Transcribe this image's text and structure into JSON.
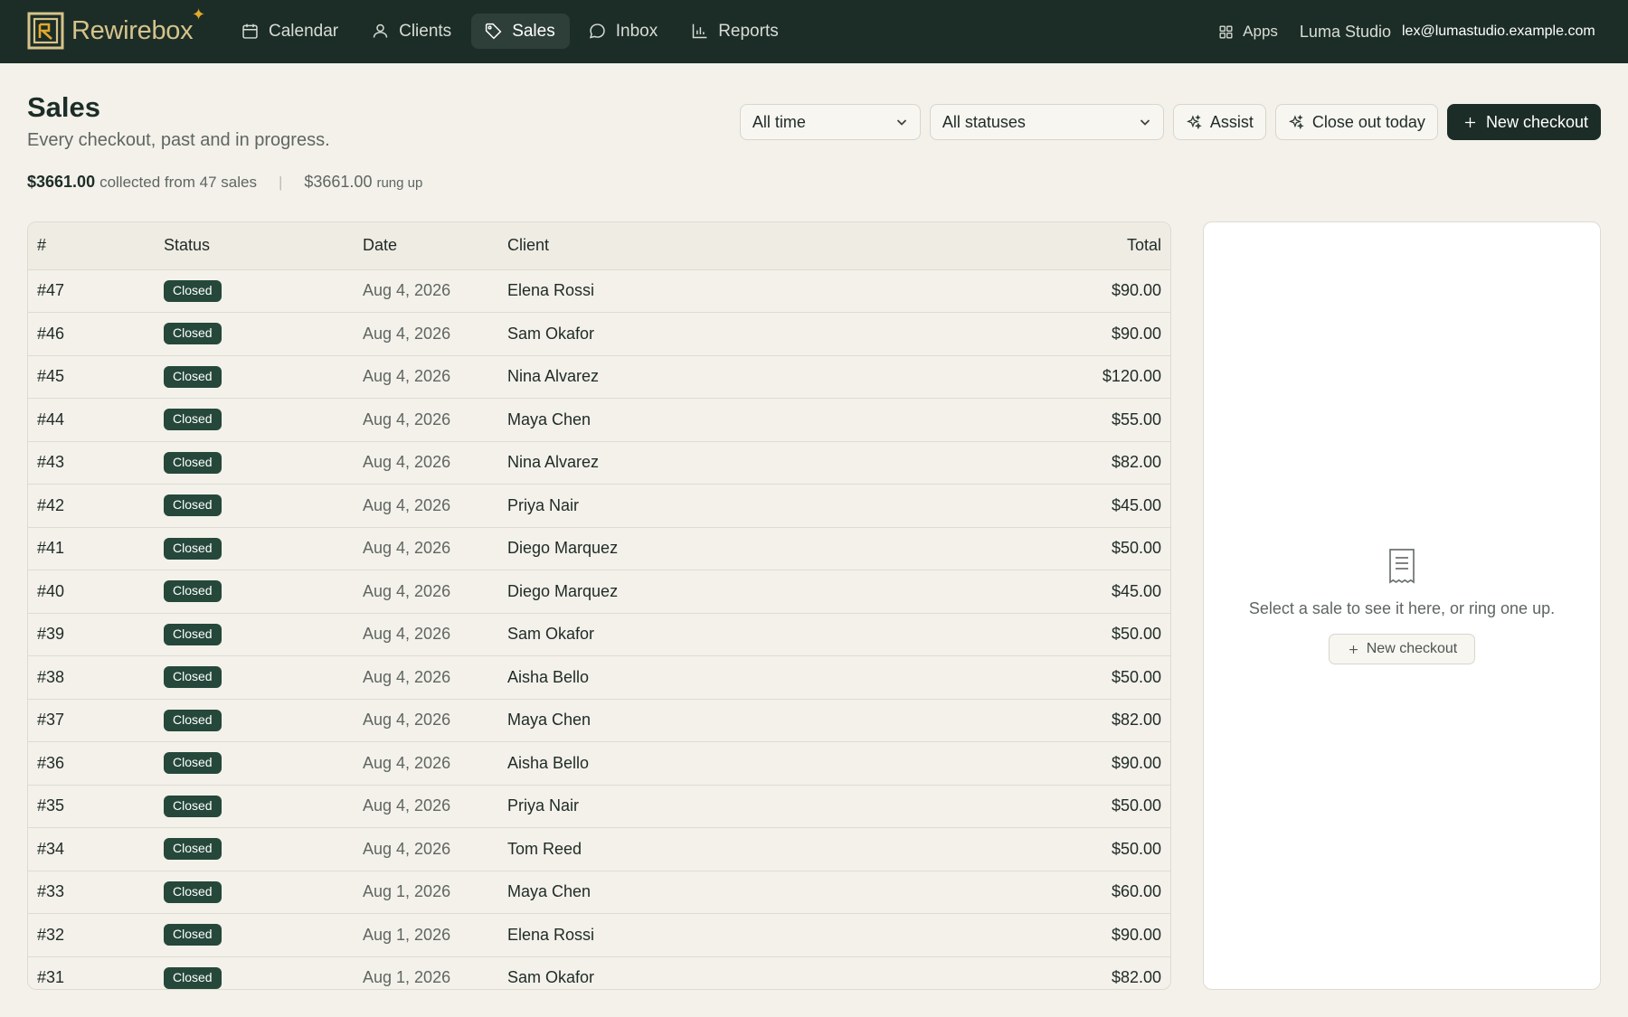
{
  "app": {
    "name": "Rewirebox",
    "org": "Luma Studio",
    "user_email": "lex@lumastudio.example.com",
    "apps_label": "Apps"
  },
  "nav": {
    "items": [
      {
        "label": "Calendar",
        "icon": "calendar-icon",
        "active": false
      },
      {
        "label": "Clients",
        "icon": "user-icon",
        "active": false
      },
      {
        "label": "Sales",
        "icon": "tag-icon",
        "active": true
      },
      {
        "label": "Inbox",
        "icon": "chat-bubble-icon",
        "active": false
      },
      {
        "label": "Reports",
        "icon": "bar-chart-icon",
        "active": false
      }
    ]
  },
  "header": {
    "title": "Sales",
    "subtitle": "Every checkout, past and in progress.",
    "collected_amount": "$3661.00",
    "collected_text": "collected from 47 sales",
    "rung_amount": "$3661.00",
    "rung_text": "rung up"
  },
  "controls": {
    "time_filter": "All time",
    "status_filter": "All statuses",
    "assist_label": "Assist",
    "close_out_label": "Close out today",
    "new_checkout_label": "New checkout"
  },
  "table": {
    "columns": [
      "#",
      "Status",
      "Date",
      "Client",
      "Total"
    ],
    "rows": [
      {
        "id": "#47",
        "status": "Closed",
        "date": "Aug 4, 2026",
        "client": "Elena Rossi",
        "total": "$90.00"
      },
      {
        "id": "#46",
        "status": "Closed",
        "date": "Aug 4, 2026",
        "client": "Sam Okafor",
        "total": "$90.00"
      },
      {
        "id": "#45",
        "status": "Closed",
        "date": "Aug 4, 2026",
        "client": "Nina Alvarez",
        "total": "$120.00"
      },
      {
        "id": "#44",
        "status": "Closed",
        "date": "Aug 4, 2026",
        "client": "Maya Chen",
        "total": "$55.00"
      },
      {
        "id": "#43",
        "status": "Closed",
        "date": "Aug 4, 2026",
        "client": "Nina Alvarez",
        "total": "$82.00"
      },
      {
        "id": "#42",
        "status": "Closed",
        "date": "Aug 4, 2026",
        "client": "Priya Nair",
        "total": "$45.00"
      },
      {
        "id": "#41",
        "status": "Closed",
        "date": "Aug 4, 2026",
        "client": "Diego Marquez",
        "total": "$50.00"
      },
      {
        "id": "#40",
        "status": "Closed",
        "date": "Aug 4, 2026",
        "client": "Diego Marquez",
        "total": "$45.00"
      },
      {
        "id": "#39",
        "status": "Closed",
        "date": "Aug 4, 2026",
        "client": "Sam Okafor",
        "total": "$50.00"
      },
      {
        "id": "#38",
        "status": "Closed",
        "date": "Aug 4, 2026",
        "client": "Aisha Bello",
        "total": "$50.00"
      },
      {
        "id": "#37",
        "status": "Closed",
        "date": "Aug 4, 2026",
        "client": "Maya Chen",
        "total": "$82.00"
      },
      {
        "id": "#36",
        "status": "Closed",
        "date": "Aug 4, 2026",
        "client": "Aisha Bello",
        "total": "$90.00"
      },
      {
        "id": "#35",
        "status": "Closed",
        "date": "Aug 4, 2026",
        "client": "Priya Nair",
        "total": "$50.00"
      },
      {
        "id": "#34",
        "status": "Closed",
        "date": "Aug 4, 2026",
        "client": "Tom Reed",
        "total": "$50.00"
      },
      {
        "id": "#33",
        "status": "Closed",
        "date": "Aug 1, 2026",
        "client": "Maya Chen",
        "total": "$60.00"
      },
      {
        "id": "#32",
        "status": "Closed",
        "date": "Aug 1, 2026",
        "client": "Elena Rossi",
        "total": "$90.00"
      },
      {
        "id": "#31",
        "status": "Closed",
        "date": "Aug 1, 2026",
        "client": "Sam Okafor",
        "total": "$82.00"
      }
    ]
  },
  "side_panel": {
    "message": "Select a sale to see it here, or ring one up.",
    "button_label": "New checkout",
    "icon": "receipt-icon"
  },
  "colors": {
    "topbar": "#1c2d27",
    "badge": "#25483b",
    "accent": "#e3a92c"
  }
}
